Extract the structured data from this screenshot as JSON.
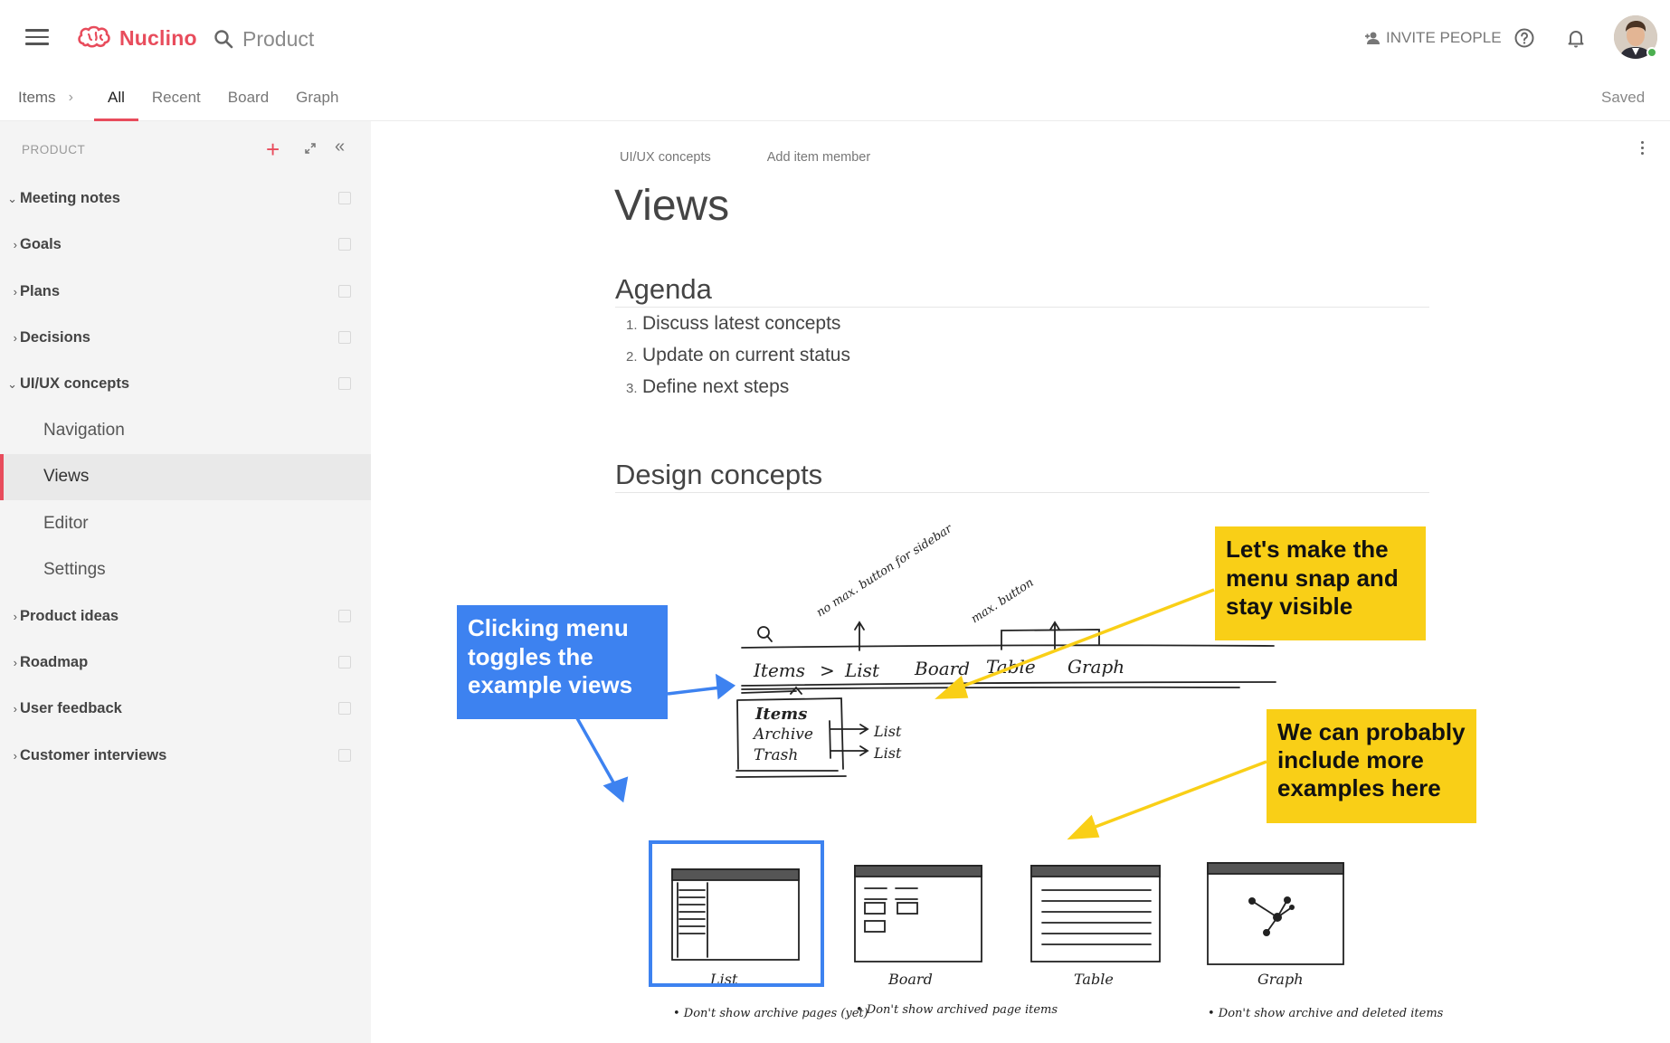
{
  "app": {
    "name": "Nuclino",
    "brand_color": "#e84c5c"
  },
  "header": {
    "search_text": "Product",
    "invite_label": "INVITE PEOPLE"
  },
  "subnav": {
    "breadcrumb": "Items",
    "tabs": [
      "All",
      "Recent",
      "Board",
      "Graph"
    ],
    "active_tab": "All",
    "status": "Saved"
  },
  "sidebar": {
    "heading": "PRODUCT",
    "items": [
      {
        "label": "Meeting notes",
        "caret": "⌄"
      },
      {
        "label": "Goals",
        "caret": "›"
      },
      {
        "label": "Plans",
        "caret": "›"
      },
      {
        "label": "Decisions",
        "caret": "›"
      },
      {
        "label": "UI/UX concepts",
        "caret": "⌄"
      },
      {
        "label": "Navigation"
      },
      {
        "label": "Views",
        "selected": true
      },
      {
        "label": "Editor"
      },
      {
        "label": "Settings"
      },
      {
        "label": "Product ideas",
        "caret": "›"
      },
      {
        "label": "Roadmap",
        "caret": "›"
      },
      {
        "label": "User feedback",
        "caret": "›"
      },
      {
        "label": "Customer interviews",
        "caret": "›"
      }
    ]
  },
  "document": {
    "parent": "UI/UX concepts",
    "add_member": "Add item member",
    "title": "Views",
    "sections": [
      "Agenda",
      "Design concepts"
    ],
    "agenda": [
      {
        "num": "1.",
        "text": "Discuss latest concepts"
      },
      {
        "num": "2.",
        "text": "Update on current status"
      },
      {
        "num": "3.",
        "text": "Define next steps"
      }
    ],
    "callouts": {
      "blue": "Clicking menu toggles the example views",
      "yellow_top": "Let's make the menu snap and stay visible",
      "yellow_bottom": "We can probably include more examples here"
    },
    "sketch": {
      "nav_words": [
        "Items",
        ">",
        "List",
        "Board",
        "Table",
        "Graph"
      ],
      "menu_words": [
        "Items",
        "Archive",
        "Trash"
      ],
      "arrow_words": [
        "List",
        "List"
      ],
      "notes": [
        "no max. button for sidebar",
        "max. button"
      ],
      "thumb_labels": [
        "List",
        "Board",
        "Table",
        "Graph"
      ],
      "thumb_notes": [
        "• Don't show archive pages (yet)",
        "• Don't show archived page items",
        "",
        "• Don't show archive and deleted items"
      ]
    }
  }
}
